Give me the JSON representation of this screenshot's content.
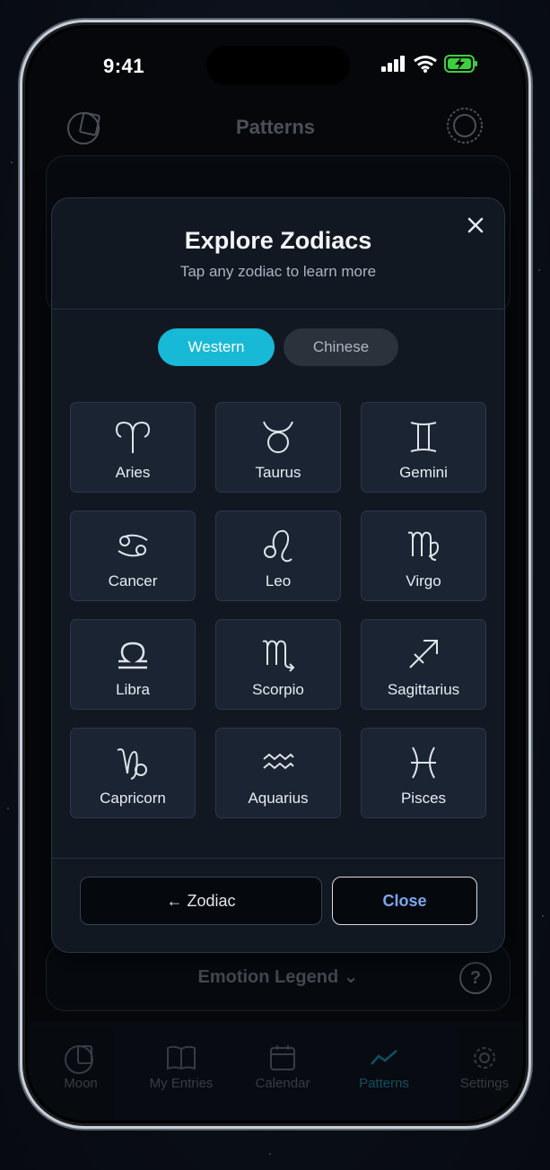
{
  "status_bar": {
    "time": "9:41"
  },
  "background": {
    "title": "Patterns",
    "legend_label": "Emotion Legend",
    "legend_help": "?",
    "tabs": [
      {
        "label": "Moon",
        "icon": "moon-journal-icon"
      },
      {
        "label": "My Entries",
        "icon": "book-icon"
      },
      {
        "label": "Calendar",
        "icon": "calendar-icon"
      },
      {
        "label": "Patterns",
        "icon": "trend-icon",
        "active": true
      },
      {
        "label": "Settings",
        "icon": "gear-icon"
      }
    ]
  },
  "modal": {
    "title": "Explore Zodiacs",
    "subtitle": "Tap any zodiac to learn more",
    "segments": {
      "western": "Western",
      "chinese": "Chinese",
      "selected": "Western"
    },
    "zodiacs": [
      {
        "name": "Aries",
        "icon": "aries-icon"
      },
      {
        "name": "Taurus",
        "icon": "taurus-icon"
      },
      {
        "name": "Gemini",
        "icon": "gemini-icon"
      },
      {
        "name": "Cancer",
        "icon": "cancer-icon"
      },
      {
        "name": "Leo",
        "icon": "leo-icon"
      },
      {
        "name": "Virgo",
        "icon": "virgo-icon"
      },
      {
        "name": "Libra",
        "icon": "libra-icon"
      },
      {
        "name": "Scorpio",
        "icon": "scorpio-icon"
      },
      {
        "name": "Sagittarius",
        "icon": "sagittarius-icon"
      },
      {
        "name": "Capricorn",
        "icon": "capricorn-icon"
      },
      {
        "name": "Aquarius",
        "icon": "aquarius-icon"
      },
      {
        "name": "Pisces",
        "icon": "pisces-icon"
      }
    ],
    "back_label": "← Zodiac",
    "close_label": "Close"
  },
  "colors": {
    "accent": "#17b9d6",
    "modal_bg": "#111822",
    "tile_bg": "#1a2433",
    "close_text": "#7aa8ee"
  }
}
